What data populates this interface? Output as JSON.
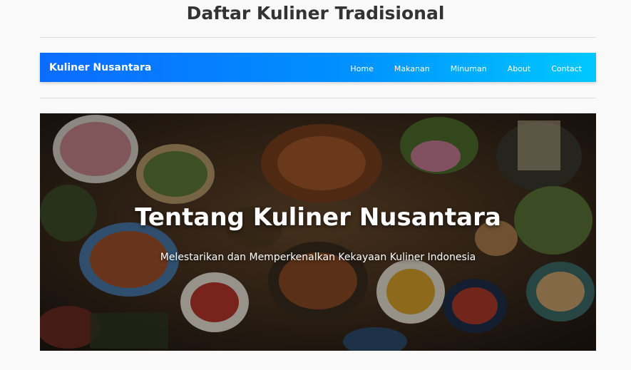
{
  "page": {
    "title": "Daftar Kuliner Tradisional"
  },
  "navbar": {
    "brand": "Kuliner Nusantara",
    "links": [
      "Home",
      "Makanan",
      "Minuman",
      "About",
      "Contact"
    ]
  },
  "hero": {
    "title": "Tentang Kuliner Nusantara",
    "subtitle": "Melestarikan dan Memperkenalkan Kekayaan Kuliner Indonesia"
  },
  "colors": {
    "page_background": "#f9f9f9",
    "title_text": "#333333",
    "navbar_gradient_start": "#0a6cff",
    "navbar_gradient_end": "#00c8ff",
    "nav_text": "#ffffff"
  }
}
